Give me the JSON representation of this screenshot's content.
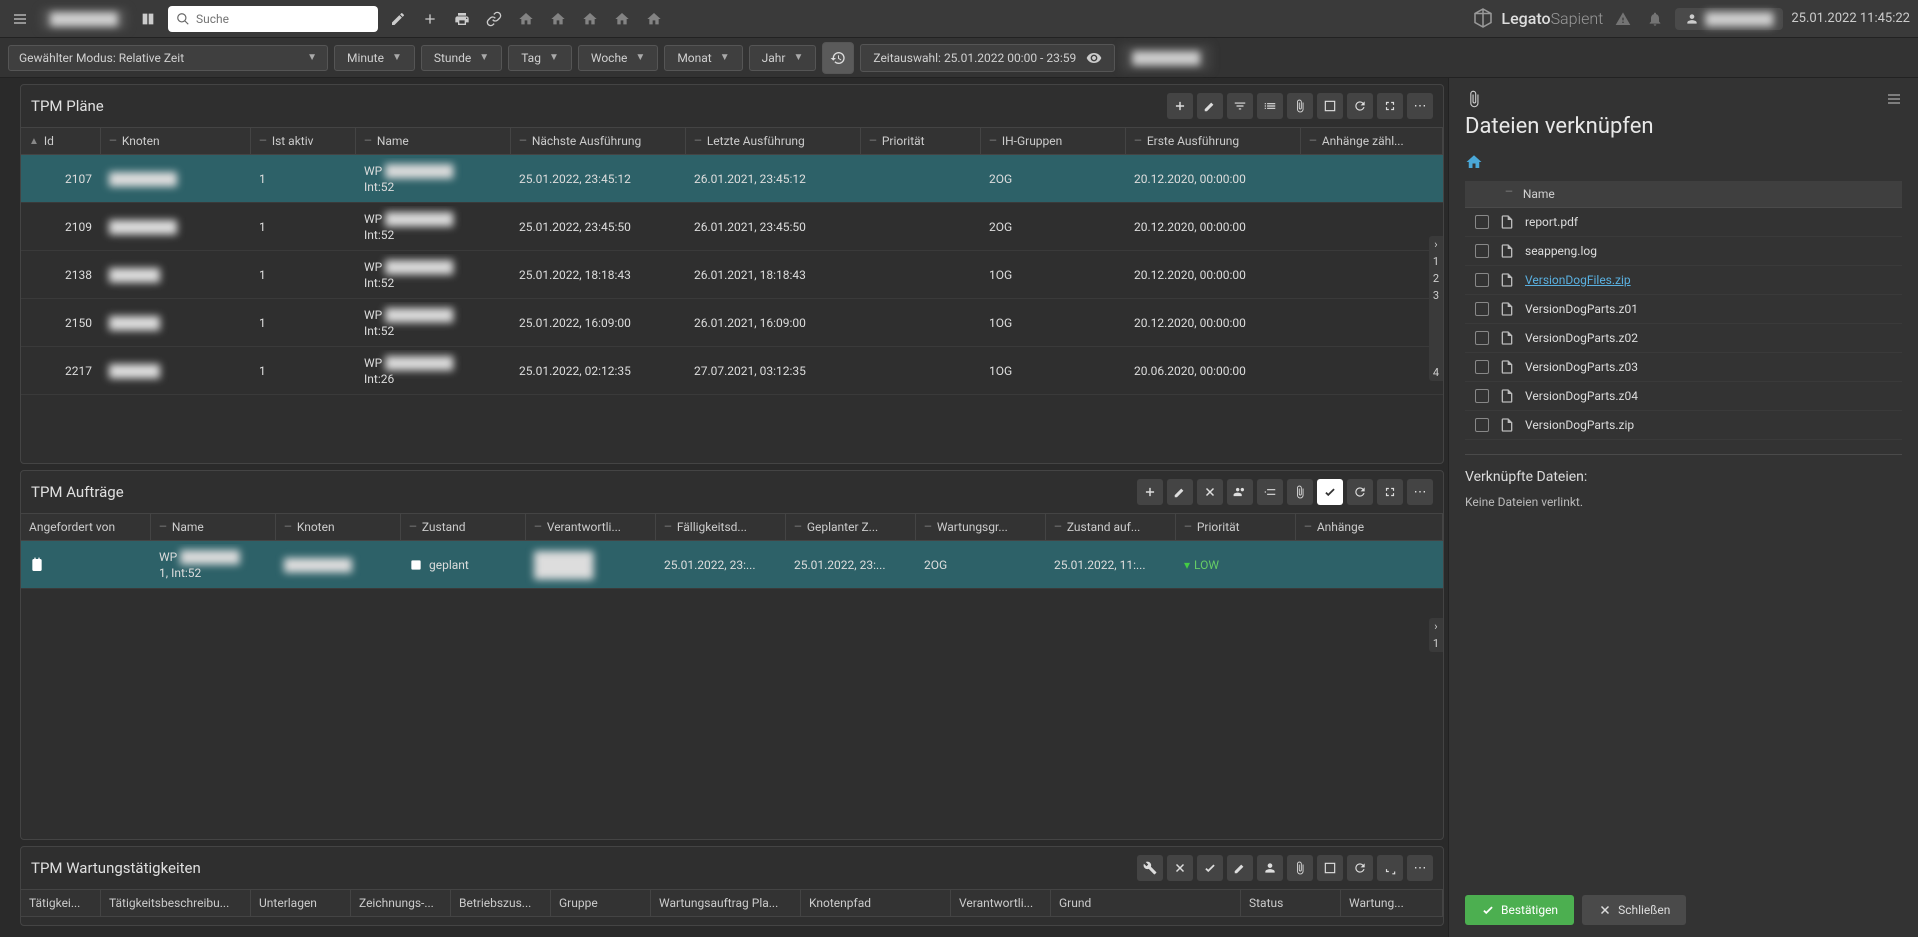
{
  "header": {
    "search_placeholder": "Suche",
    "user_blur": "████████",
    "brand_a": "Legato",
    "brand_b": "Sapient",
    "datetime": "25.01.2022 11:45:22"
  },
  "toolbar": {
    "mode_label": "Gewählter Modus: Relative Zeit",
    "time_units": [
      "Minute",
      "Stunde",
      "Tag",
      "Woche",
      "Monat",
      "Jahr"
    ],
    "timesel": "Zeitauswahl: 25.01.2022 00:00 - 23:59",
    "action_blur": "████████"
  },
  "panel_plaene": {
    "title": "TPM Pläne",
    "cols": [
      "Id",
      "Knoten",
      "Ist aktiv",
      "Name",
      "Nächste Ausführung",
      "Letzte Ausführung",
      "Priorität",
      "IH-Gruppen",
      "Erste Ausführung",
      "Anhänge zähl..."
    ],
    "rows": [
      {
        "id": "2107",
        "knoten": "████████",
        "aktiv": "1",
        "name_pre": "WP",
        "name_blur": "████████",
        "int": "Int:52",
        "next": "25.01.2022, 23:45:12",
        "last": "26.01.2021, 23:45:12",
        "prio": "",
        "ih": "2OG",
        "first": "20.12.2020, 00:00:00",
        "sel": true
      },
      {
        "id": "2109",
        "knoten": "████████",
        "aktiv": "1",
        "name_pre": "WP",
        "name_blur": "████████",
        "int": "Int:52",
        "next": "25.01.2022, 23:45:50",
        "last": "26.01.2021, 23:45:50",
        "prio": "",
        "ih": "2OG",
        "first": "20.12.2020, 00:00:00",
        "sel": false
      },
      {
        "id": "2138",
        "knoten": "██████",
        "aktiv": "1",
        "name_pre": "WP",
        "name_blur": "████████",
        "int": "Int:52",
        "next": "25.01.2022, 18:18:43",
        "last": "26.01.2021, 18:18:43",
        "prio": "",
        "ih": "1OG",
        "first": "20.12.2020, 00:00:00",
        "sel": false
      },
      {
        "id": "2150",
        "knoten": "██████",
        "aktiv": "1",
        "name_pre": "WP",
        "name_blur": "████████",
        "int": "Int:52",
        "next": "25.01.2022, 16:09:00",
        "last": "26.01.2021, 16:09:00",
        "prio": "",
        "ih": "1OG",
        "first": "20.12.2020, 00:00:00",
        "sel": false
      },
      {
        "id": "2217",
        "knoten": "██████",
        "aktiv": "1",
        "name_pre": "WP",
        "name_blur": "████████",
        "int": "Int:26",
        "next": "25.01.2022, 02:12:35",
        "last": "27.07.2021, 03:12:35",
        "prio": "",
        "ih": "1OG",
        "first": "20.06.2020, 00:00:00",
        "sel": false
      }
    ],
    "pager": [
      "1",
      "2",
      "3",
      "4"
    ]
  },
  "panel_auftraege": {
    "title": "TPM Aufträge",
    "cols": [
      "Angefordert von",
      "Name",
      "Knoten",
      "Zustand",
      "Verantwortli...",
      "Fälligkeitsd...",
      "Geplanter Z...",
      "Wartungsgr...",
      "Zustand auf...",
      "Priorität",
      "Anhänge"
    ],
    "row": {
      "name_pre": "WP",
      "name_blur": "███████",
      "name_sub": "1, Int:52",
      "knoten": "████████",
      "zustand": "geplant",
      "verantw": "███████\n███████",
      "faellig": "25.01.2022, 23:...",
      "geplant": "25.01.2022, 23:...",
      "wgr": "2OG",
      "zauf": "25.01.2022, 11:...",
      "prio": "LOW"
    },
    "pager": [
      "1"
    ]
  },
  "panel_wartung": {
    "title": "TPM Wartungstätigkeiten",
    "cols": [
      "Tätigkei...",
      "Tätigkeitsbeschreibu...",
      "Unterlagen",
      "Zeichnungs-...",
      "Betriebszus...",
      "Gruppe",
      "Wartungsauftrag Pla...",
      "Knotenpfad",
      "Verantwortli...",
      "Grund",
      "Status",
      "Wartung..."
    ]
  },
  "right": {
    "title": "Dateien verknüpfen",
    "col_name": "Name",
    "files": [
      {
        "name": "report.pdf",
        "link": false
      },
      {
        "name": "seappeng.log",
        "link": false
      },
      {
        "name": "VersionDogFiles.zip",
        "link": true
      },
      {
        "name": "VersionDogParts.z01",
        "link": false
      },
      {
        "name": "VersionDogParts.z02",
        "link": false
      },
      {
        "name": "VersionDogParts.z03",
        "link": false
      },
      {
        "name": "VersionDogParts.z04",
        "link": false
      },
      {
        "name": "VersionDogParts.zip",
        "link": false
      }
    ],
    "linked_title": "Verknüpfte Dateien:",
    "no_files": "Keine Dateien verlinkt.",
    "confirm": "Bestätigen",
    "close": "Schließen"
  }
}
